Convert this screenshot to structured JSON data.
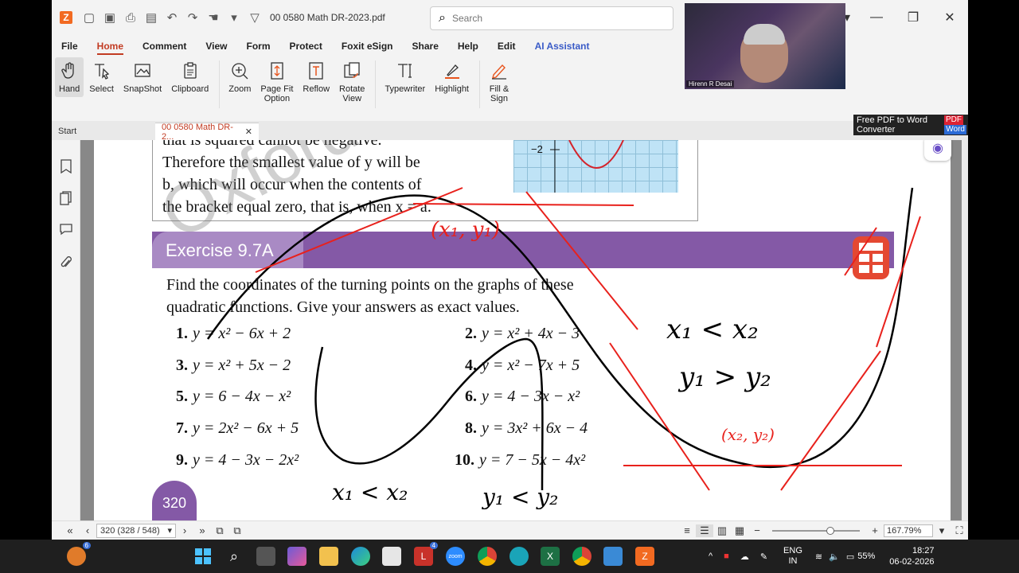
{
  "titlebar": {
    "doc_title": "00 0580 Math DR-2023.pdf",
    "search_placeholder": "Search"
  },
  "menu": [
    "File",
    "Home",
    "Comment",
    "View",
    "Form",
    "Protect",
    "Foxit eSign",
    "Share",
    "Help",
    "Edit",
    "AI Assistant"
  ],
  "ribbon": {
    "hand": "Hand",
    "select": "Select",
    "snapshot": "SnapShot",
    "clipboard": "Clipboard",
    "zoom": "Zoom",
    "page_fit_1": "Page Fit",
    "page_fit_2": "Option",
    "reflow": "Reflow",
    "rotate_1": "Rotate",
    "rotate_2": "View",
    "typewriter": "Typewriter",
    "highlight": "Highlight",
    "fill_1": "Fill &",
    "fill_2": "Sign"
  },
  "tabs": {
    "start": "Start",
    "current": "00 0580 Math DR-2..."
  },
  "promo": {
    "line1": "Free PDF to Word",
    "line2": "Converter",
    "pdf": "PDF",
    "word": "Word"
  },
  "webcam_name": "Hirenn R Desai",
  "page": {
    "prev_line1": "that is squared cannot be negative.",
    "prev_line2": "Therefore the smallest value of y will be",
    "prev_line3": "b, which will occur when the contents of",
    "prev_line4": "the bracket equal zero, that is, when x = a.",
    "graph_label": "−2",
    "exercise_title": "Exercise 9.7A",
    "intro_1": "Find the coordinates of the turning points on the graphs of these",
    "intro_2": "quadratic functions. Give your answers as exact values.",
    "exercises": [
      {
        "n": "1.",
        "eq": "y = x² − 6x + 2"
      },
      {
        "n": "2.",
        "eq": "y = x² + 4x − 3"
      },
      {
        "n": "3.",
        "eq": "y = x² + 5x − 2"
      },
      {
        "n": "4.",
        "eq": "y = x² − 7x + 5"
      },
      {
        "n": "5.",
        "eq": "y = 6 − 4x − x²"
      },
      {
        "n": "6.",
        "eq": "y = 4 − 3x − x²"
      },
      {
        "n": "7.",
        "eq": "y = 2x² − 6x + 5"
      },
      {
        "n": "8.",
        "eq": "y = 3x² + 6x − 4"
      },
      {
        "n": "9.",
        "eq": "y = 4 − 3x − 2x²"
      },
      {
        "n": "10.",
        "eq": "y = 7 − 5x − 4x²"
      }
    ],
    "page_number": "320",
    "watermark": "Oxford Evaluation"
  },
  "annotations": {
    "point1": "(x₁, y₁)",
    "point2": "(x₂, y₂)",
    "ineq1": "x₁ < x₂",
    "ineq2": "y₁ > y₂",
    "ineq3": "x₁ < x₂",
    "ineq4": "y₁ < y₂"
  },
  "statusbar": {
    "page_value": "320 (328 / 548)",
    "zoom": "167.79%"
  },
  "taskbar": {
    "lang1": "ENG",
    "lang2": "IN",
    "battery": "55%",
    "time": "18:27",
    "date": "06-02-2026",
    "weather_badge": "6",
    "l_badge": "4"
  },
  "colors": {
    "accent": "#c23b22",
    "exercise_purple": "#8459a6",
    "ink_red": "#e8211c",
    "ink_black": "#000000"
  }
}
